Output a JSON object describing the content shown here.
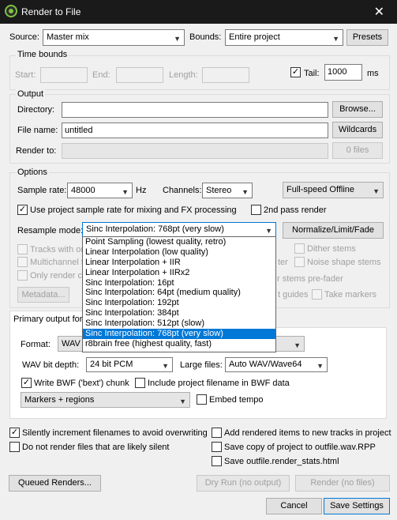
{
  "window": {
    "title": "Render to File",
    "close_icon": "close-icon"
  },
  "source": {
    "label": "Source:",
    "value": "Master mix"
  },
  "bounds": {
    "label": "Bounds:",
    "value": "Entire project",
    "presets_label": "Presets"
  },
  "time_bounds": {
    "title": "Time bounds",
    "start_label": "Start:",
    "end_label": "End:",
    "length_label": "Length:",
    "start_value": "",
    "end_value": "",
    "length_value": "",
    "tail_label": "Tail:",
    "tail_checked": true,
    "tail_value": "1000",
    "tail_unit": "ms"
  },
  "output": {
    "title": "Output",
    "directory_label": "Directory:",
    "directory_value": "",
    "browse_label": "Browse...",
    "filename_label": "File name:",
    "filename_value": "untitled",
    "wildcards_label": "Wildcards",
    "render_to_label": "Render to:",
    "render_to_value": "",
    "files_label": "0 files"
  },
  "options": {
    "title": "Options",
    "sample_rate_label": "Sample rate:",
    "sample_rate_value": "48000",
    "sample_rate_unit": "Hz",
    "channels_label": "Channels:",
    "channels_value": "Stereo",
    "speed_value": "Full-speed Offline",
    "use_project_rate_label": "Use project sample rate for mixing and FX processing",
    "use_project_rate_checked": true,
    "second_pass_label": "2nd pass render",
    "second_pass_checked": false,
    "resample_label": "Resample mode:",
    "resample_value": "Sinc Interpolation: 768pt (very slow)",
    "normalize_label": "Normalize/Limit/Fade",
    "tracks_label": "Tracks with on",
    "multichannel_label": "Multichannel t",
    "only_render_label": "Only render ch",
    "dither_label": "Dither stems",
    "noise_label": "Noise shape stems",
    "ter_fragment": "ter",
    "stems_prefader_fragment": "r stems pre-fader",
    "metadata_label": "Metadata...",
    "guides_fragment": "t guides",
    "take_markers_label": "Take markers",
    "b_fragment": "b"
  },
  "resample_options": [
    "Point Sampling (lowest quality, retro)",
    "Linear Interpolation (low quality)",
    "Linear Interpolation + IIR",
    "Linear Interpolation + IIRx2",
    "Sinc Interpolation: 16pt",
    "Sinc Interpolation: 64pt (medium quality)",
    "Sinc Interpolation: 192pt",
    "Sinc Interpolation: 384pt",
    "Sinc Interpolation: 512pt (slow)",
    "Sinc Interpolation: 768pt (very slow)",
    "r8brain free (highest quality, fast)"
  ],
  "resample_selected_index": 9,
  "primary": {
    "tab_label": "Primary output form",
    "format_label": "Format:",
    "format_value": "WAV",
    "bit_depth_label": "WAV bit depth:",
    "bit_depth_value": "24 bit PCM",
    "large_files_label": "Large files:",
    "large_files_value": "Auto WAV/Wave64",
    "bwf_label": "Write BWF ('bext') chunk",
    "bwf_checked": true,
    "include_filename_label": "Include project filename in BWF data",
    "include_filename_checked": false,
    "markers_value": "Markers + regions",
    "embed_tempo_label": "Embed tempo",
    "embed_tempo_checked": false
  },
  "bottom": {
    "silently_label": "Silently increment filenames to avoid overwriting",
    "silently_checked": true,
    "do_not_render_label": "Do not render files that are likely silent",
    "do_not_render_checked": false,
    "add_items_label": "Add rendered items to new tracks in project",
    "add_items_checked": false,
    "save_copy_label": "Save copy of project to outfile.wav.RPP",
    "save_copy_checked": false,
    "save_stats_label": "Save outfile.render_stats.html",
    "save_stats_checked": false,
    "queued_label": "Queued Renders...",
    "dry_run_label": "Dry Run (no output)",
    "render_label": "Render (no files)",
    "cancel_label": "Cancel",
    "save_settings_label": "Save Settings"
  },
  "colors": {
    "titlebar": "#1a1a1a",
    "selection": "#0078d7",
    "background": "#f0f0f0"
  }
}
